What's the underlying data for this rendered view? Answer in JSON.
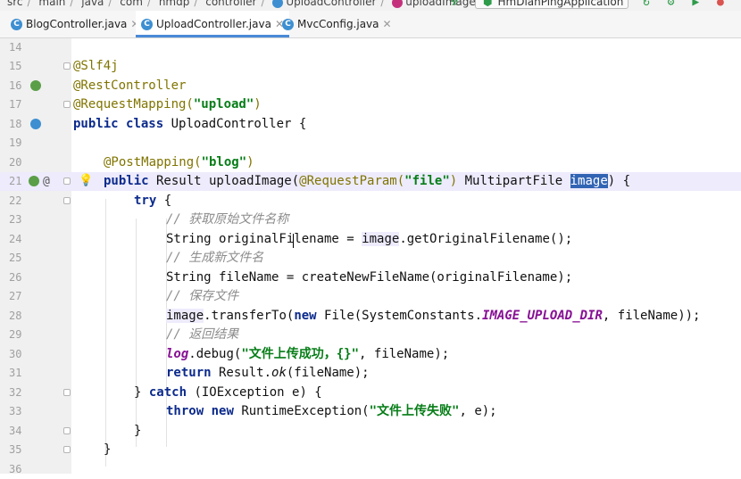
{
  "breadcrumb": {
    "items": [
      "src",
      "main",
      "java",
      "com",
      "hmdp",
      "controller",
      "UploadController",
      "uploadImage"
    ]
  },
  "run_config": {
    "label": "HmDianPingApplication"
  },
  "tabs": [
    {
      "label": "BlogController.java",
      "icon": "class-icon",
      "active": false
    },
    {
      "label": "UploadController.java",
      "icon": "class-icon",
      "active": true
    },
    {
      "label": "MvcConfig.java",
      "icon": "class-icon",
      "active": false
    }
  ],
  "colors": {
    "keyword": "#0b2a8c",
    "annotation": "#807400",
    "string": "#067d17",
    "comment": "#8c8c8c",
    "field": "#871094",
    "selection": "#3264b4"
  },
  "code": {
    "line_numbers": [
      "14",
      "15",
      "16",
      "17",
      "18",
      "19",
      "20",
      "21",
      "22",
      "23",
      "24",
      "25",
      "26",
      "27",
      "28",
      "29",
      "30",
      "31",
      "32",
      "33",
      "34",
      "35",
      "36"
    ],
    "l15": "@Slf4j",
    "l16": "@RestController",
    "l17_a": "@RequestMapping(",
    "l17_s": "\"upload\"",
    "l17_b": ")",
    "l18_kw1": "public",
    "l18_kw2": "class",
    "l18_rest": " UploadController {",
    "l20_a": "@PostMapping(",
    "l20_s": "\"blog\"",
    "l20_b": ")",
    "l21_kw": "public",
    "l21_a": " Result uploadImage(",
    "l21_ann": "@RequestParam(",
    "l21_s": "\"file\"",
    "l21_b": ")",
    "l21_c": " MultipartFile ",
    "l21_param": "image",
    "l21_d": ") {",
    "l22_kw": "try",
    "l22_rest": " {",
    "l23": "// 获取原始文件名称",
    "l24_a": "String originalFilename = ",
    "l24_img": "image",
    "l24_b": ".getOriginalFilename();",
    "l25": "// 生成新文件名",
    "l26": "String fileName = createNewFileName(originalFilename);",
    "l27": "// 保存文件",
    "l28_img": "image",
    "l28_a": ".transferTo(",
    "l28_kw": "new",
    "l28_b": " File(SystemConstants.",
    "l28_field": "IMAGE_UPLOAD_DIR",
    "l28_c": ", fileName));",
    "l29": "// 返回结果",
    "l30_log": "log",
    "l30_a": ".debug(",
    "l30_s": "\"文件上传成功，{}\"",
    "l30_b": ", fileName);",
    "l31_kw": "return",
    "l31_a": " Result.",
    "l31_ok": "ok",
    "l31_b": "(fileName);",
    "l32_a": "} ",
    "l32_kw": "catch",
    "l32_b": " (IOException e) {",
    "l33_kw1": "throw",
    "l33_kw2": "new",
    "l33_a": " RuntimeException(",
    "l33_s": "\"文件上传失败\"",
    "l33_b": ", e);",
    "l34": "}",
    "l35": "}"
  }
}
